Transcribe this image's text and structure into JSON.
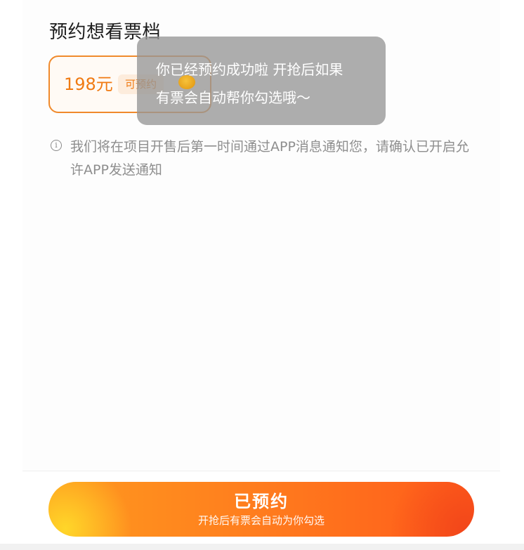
{
  "section": {
    "title": "预约想看票档"
  },
  "tiers": [
    {
      "price": "198元",
      "badge": "可预约"
    }
  ],
  "notice": {
    "icon": "info-icon",
    "text": "我们将在项目开售后第一时间通过APP消息通知您，请确认已开启允许APP发送通知"
  },
  "toast": {
    "line1": "你已经预约成功啦 开抢后如果",
    "line2": "有票会自动帮你勾选哦～"
  },
  "bottom": {
    "button_label": "已预约",
    "button_sub": "开抢后有票会自动为你勾选"
  },
  "colors": {
    "accent": "#f07a12",
    "button_start": "#ff9a1f",
    "button_end": "#ff5b1a",
    "toast_bg": "#969696"
  }
}
